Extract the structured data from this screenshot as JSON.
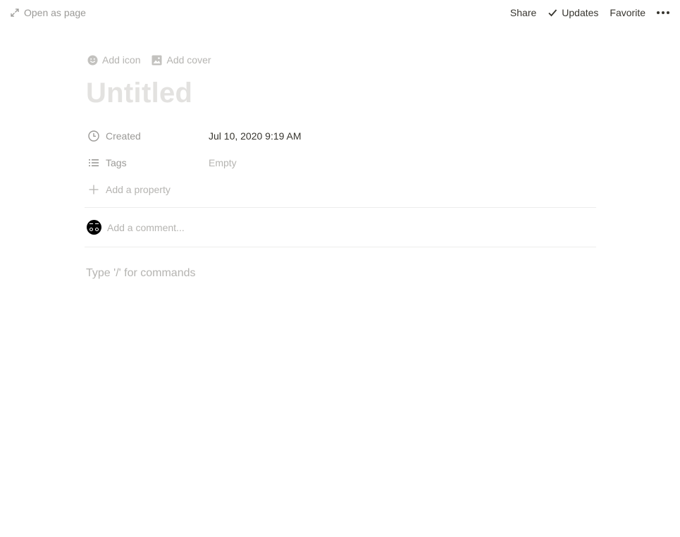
{
  "topbar": {
    "open_as_page": "Open as page",
    "share": "Share",
    "updates": "Updates",
    "favorite": "Favorite"
  },
  "page": {
    "add_icon": "Add icon",
    "add_cover": "Add cover",
    "title": "Untitled"
  },
  "properties": [
    {
      "name": "Created",
      "icon": "clock-icon",
      "value": "Jul 10, 2020 9:19 AM"
    },
    {
      "name": "Tags",
      "icon": "list-icon",
      "value": "Empty"
    }
  ],
  "add_property": "Add a property",
  "comment": {
    "placeholder": "Add a comment..."
  },
  "editor": {
    "placeholder": "Type '/' for commands"
  }
}
